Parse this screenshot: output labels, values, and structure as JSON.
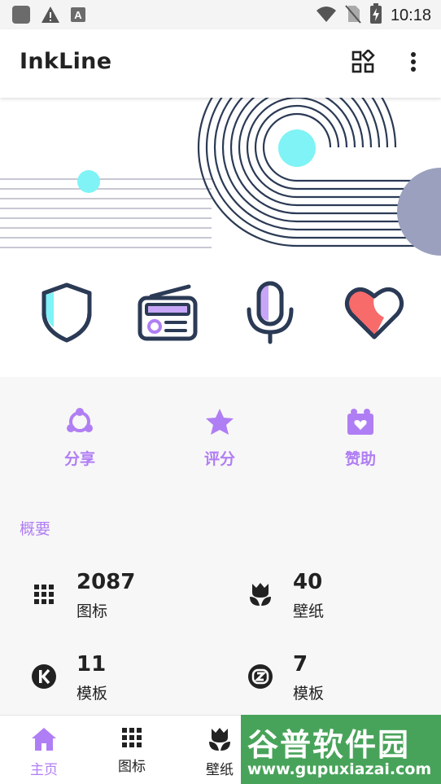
{
  "status_bar": {
    "time": "10:18"
  },
  "app_bar": {
    "title": "InkLine"
  },
  "actions": [
    {
      "label": "分享",
      "icon": "share-icon"
    },
    {
      "label": "评分",
      "icon": "star-icon"
    },
    {
      "label": "赞助",
      "icon": "gift-icon"
    }
  ],
  "overview": {
    "title": "概要",
    "stats": [
      {
        "value": "2087",
        "label": "图标",
        "icon": "grid-icon"
      },
      {
        "value": "40",
        "label": "壁纸",
        "icon": "tulip-icon"
      },
      {
        "value": "11",
        "label": "模板",
        "icon": "kwgt-icon"
      },
      {
        "value": "7",
        "label": "模板",
        "icon": "zooper-icon"
      }
    ]
  },
  "bottom_nav": [
    {
      "label": "主页",
      "icon": "home-icon",
      "active": true
    },
    {
      "label": "图标",
      "icon": "grid-icon"
    },
    {
      "label": "壁纸",
      "icon": "tulip-icon"
    }
  ],
  "watermark": {
    "main": "谷普软件园",
    "sub": "www.gupuxiazai.com"
  },
  "colors": {
    "accent": "#b07ef4",
    "ink": "#2b3a55",
    "cyan": "#7ff3f5",
    "coral": "#f76b6b"
  }
}
